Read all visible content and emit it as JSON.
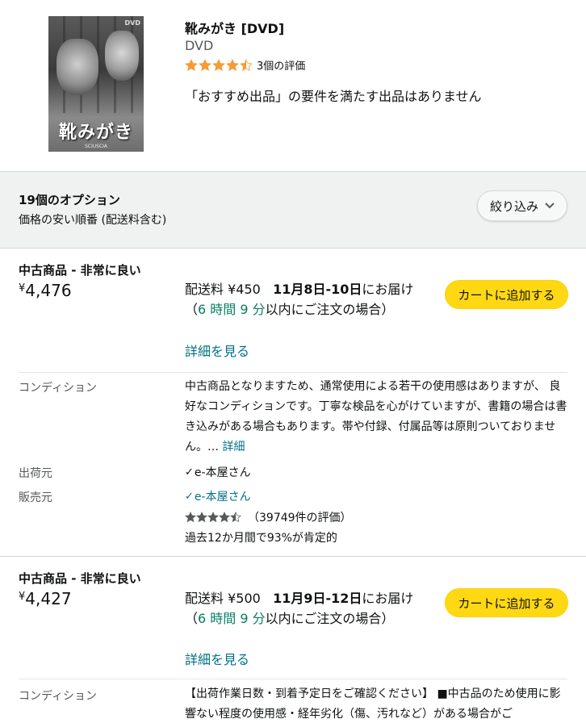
{
  "product": {
    "title": "靴みがき [DVD]",
    "format": "DVD",
    "rating_count_label": "3個の評価",
    "stars": 4.5,
    "note": "「おすすめ出品」の要件を満たす出品はありません",
    "cover_title": "靴みがき",
    "cover_subtitle": "SCIUSCIA",
    "cover_badge": "DVD"
  },
  "options": {
    "count_label": "19個のオプション",
    "sort_label": "価格の安い順番 (配送料含む)",
    "filter_label": "絞り込み"
  },
  "offers": [
    {
      "condition": "中古商品 - 非常に良い",
      "currency": "¥",
      "price": "4,476",
      "ship_prefix": "配送料 ¥450",
      "delivery": "11月8日-10日",
      "ship_mid": "にお届け（",
      "countdown": "6 時間 9 分",
      "ship_suffix": "以内にご注文の場合）",
      "details_link": "詳細を見る",
      "cart_label": "カートに追加する",
      "condition_label": "コンディション",
      "condition_text": "中古商品となりますため、通常使用による若干の使用感はありますが、 良好なコンディションです。丁寧な検品を心がけていますが、書籍の場合は書き込みがある場合もあります。帯や付録、付属品等は原則ついておりません。… ",
      "condition_more": "詳細",
      "ships_from_label": "出荷元",
      "ships_from": "e-本屋さん",
      "sold_by_label": "販売元",
      "sold_by": "e-本屋さん",
      "seller_stars": 4.5,
      "seller_ratings": "（39749件の評価）",
      "positive": "過去12か月間で93%が肯定的"
    },
    {
      "condition": "中古商品 - 非常に良い",
      "currency": "¥",
      "price": "4,427",
      "ship_prefix": "配送料 ¥500",
      "delivery": "11月9日-12日",
      "ship_mid": "にお届け（",
      "countdown": "6 時間 9 分",
      "ship_suffix": "以内にご注文の場合）",
      "details_link": "詳細を見る",
      "cart_label": "カートに追加する",
      "condition_label": "コンディション",
      "condition_text": "【出荷作業日数・到着予定日をご確認ください】 ■中古品のため使用に影響ない程度の使用感・経年劣化（傷、汚れなど）がある場合がご"
    }
  ],
  "colors": {
    "star": "#f79b34",
    "cart": "#ffd814",
    "link": "#007185",
    "green": "#067d62"
  }
}
